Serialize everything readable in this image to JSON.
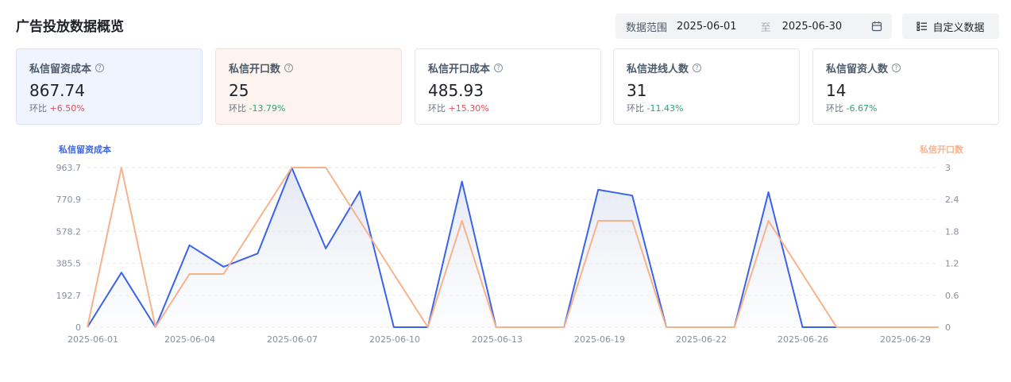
{
  "header": {
    "title": "广告投放数据概览",
    "range_label": "数据范围",
    "start_date": "2025-06-01",
    "separator": "至",
    "end_date": "2025-06-30",
    "custom_button": "自定义数据"
  },
  "cards": [
    {
      "title": "私信留资成本",
      "value": "867.74",
      "change_label": "环比",
      "change": "+6.50%",
      "trend": "up"
    },
    {
      "title": "私信开口数",
      "value": "25",
      "change_label": "环比",
      "change": "-13.79%",
      "trend": "down"
    },
    {
      "title": "私信开口成本",
      "value": "485.93",
      "change_label": "环比",
      "change": "+15.30%",
      "trend": "up"
    },
    {
      "title": "私信进线人数",
      "value": "31",
      "change_label": "环比",
      "change": "-11.43%",
      "trend": "down"
    },
    {
      "title": "私信留资人数",
      "value": "14",
      "change_label": "环比",
      "change": "-6.67%",
      "trend": "down"
    }
  ],
  "colors": {
    "primary_series": "#3b63e8",
    "secondary_series": "#f7b28c",
    "up": "#e34d59",
    "down": "#2ba471"
  },
  "chart_data": {
    "type": "line",
    "y_left_name": "私信留资成本",
    "y_right_name": "私信开口数",
    "y_left_ticks": [
      "0",
      "192.7",
      "385.5",
      "578.2",
      "770.9",
      "963.7"
    ],
    "y_right_ticks": [
      "0",
      "0.6",
      "1.2",
      "1.8",
      "2.4",
      "3"
    ],
    "ylim_left": [
      0,
      963.7
    ],
    "ylim_right": [
      0,
      3
    ],
    "x_tick_labels": [
      "2025-06-01",
      "2025-06-04",
      "2025-06-07",
      "2025-06-10",
      "2025-06-13",
      "2025-06-19",
      "2025-06-22",
      "2025-06-26",
      "2025-06-29"
    ],
    "x_tick_indices": [
      0,
      3,
      6,
      9,
      12,
      15,
      18,
      21,
      24
    ],
    "dates": [
      "2025-06-01",
      "2025-06-02",
      "2025-06-03",
      "2025-06-04",
      "2025-06-05",
      "2025-06-06",
      "2025-06-07",
      "2025-06-08",
      "2025-06-09",
      "2025-06-10",
      "2025-06-11",
      "2025-06-12",
      "2025-06-13",
      "2025-06-14",
      "2025-06-15",
      "2025-06-16",
      "2025-06-17",
      "2025-06-18",
      "2025-06-19",
      "2025-06-20",
      "2025-06-21",
      "2025-06-22",
      "2025-06-23",
      "2025-06-24",
      "2025-06-25",
      "2025-06-26"
    ],
    "series": [
      {
        "name": "私信留资成本",
        "axis": "left",
        "color": "#3b63e8",
        "area": true,
        "values": [
          0,
          330,
          0,
          495,
          365,
          445,
          963.7,
          475,
          820,
          0,
          0,
          880,
          0,
          0,
          0,
          830,
          795,
          0,
          0,
          0,
          815,
          0,
          0,
          0,
          0,
          0
        ]
      },
      {
        "name": "私信开口数",
        "axis": "right",
        "color": "#f7b28c",
        "area": false,
        "values": [
          0,
          3,
          0,
          1,
          1,
          2,
          3,
          3,
          2,
          1,
          0,
          2,
          0,
          0,
          0,
          2,
          2,
          0,
          0,
          0,
          2,
          1,
          0,
          0,
          0,
          0
        ]
      }
    ],
    "grid": true
  }
}
